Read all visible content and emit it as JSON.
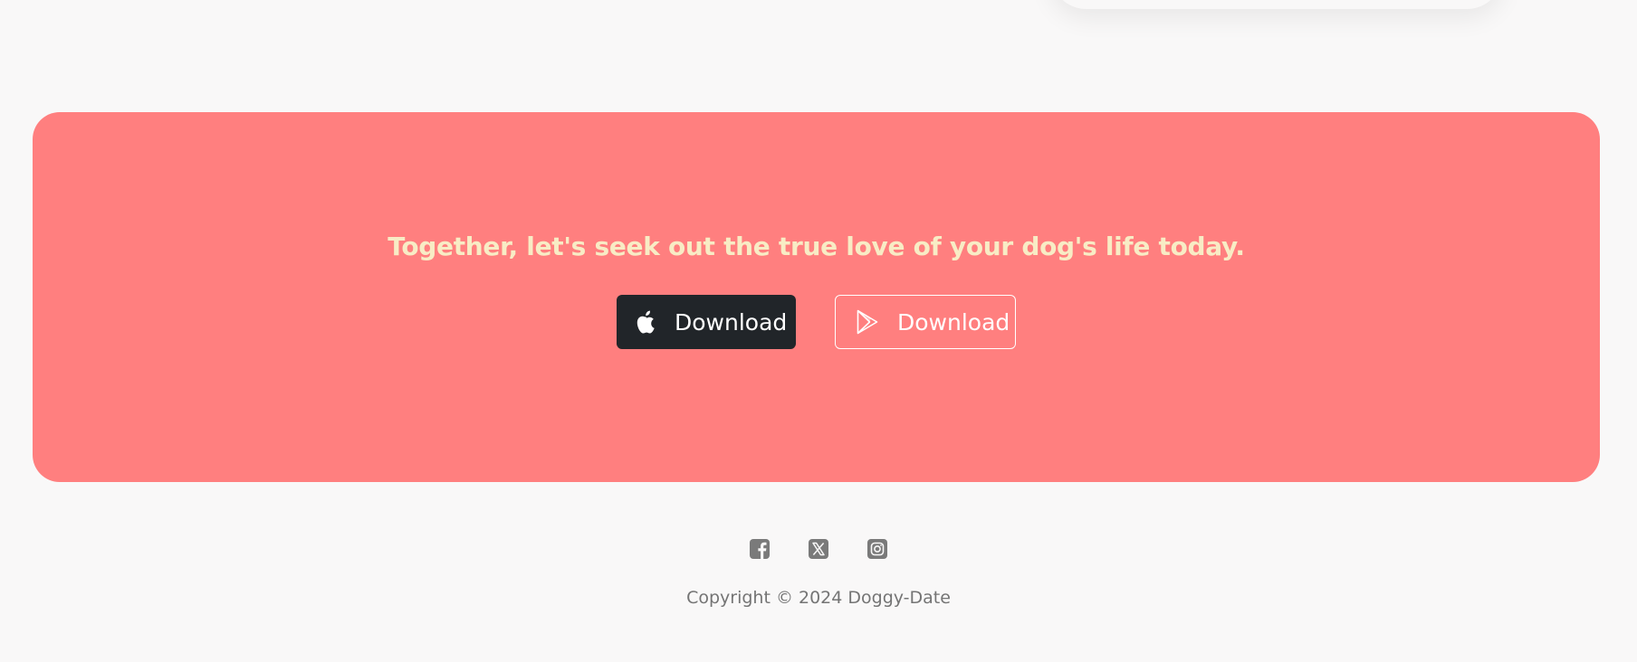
{
  "cta": {
    "heading": "Together, let's seek out the true love of your dog's life today.",
    "background_color": "#ff7f7f",
    "heading_color": "#f8ecc5",
    "buttons": [
      {
        "label": "Download",
        "icon": "apple-icon",
        "style": "filled-dark"
      },
      {
        "label": "Download",
        "icon": "google-play-icon",
        "style": "outline"
      }
    ]
  },
  "footer": {
    "social_icons": [
      "facebook-icon",
      "x-twitter-icon",
      "instagram-icon"
    ],
    "copyright": "Copyright © 2024 Doggy-Date"
  }
}
